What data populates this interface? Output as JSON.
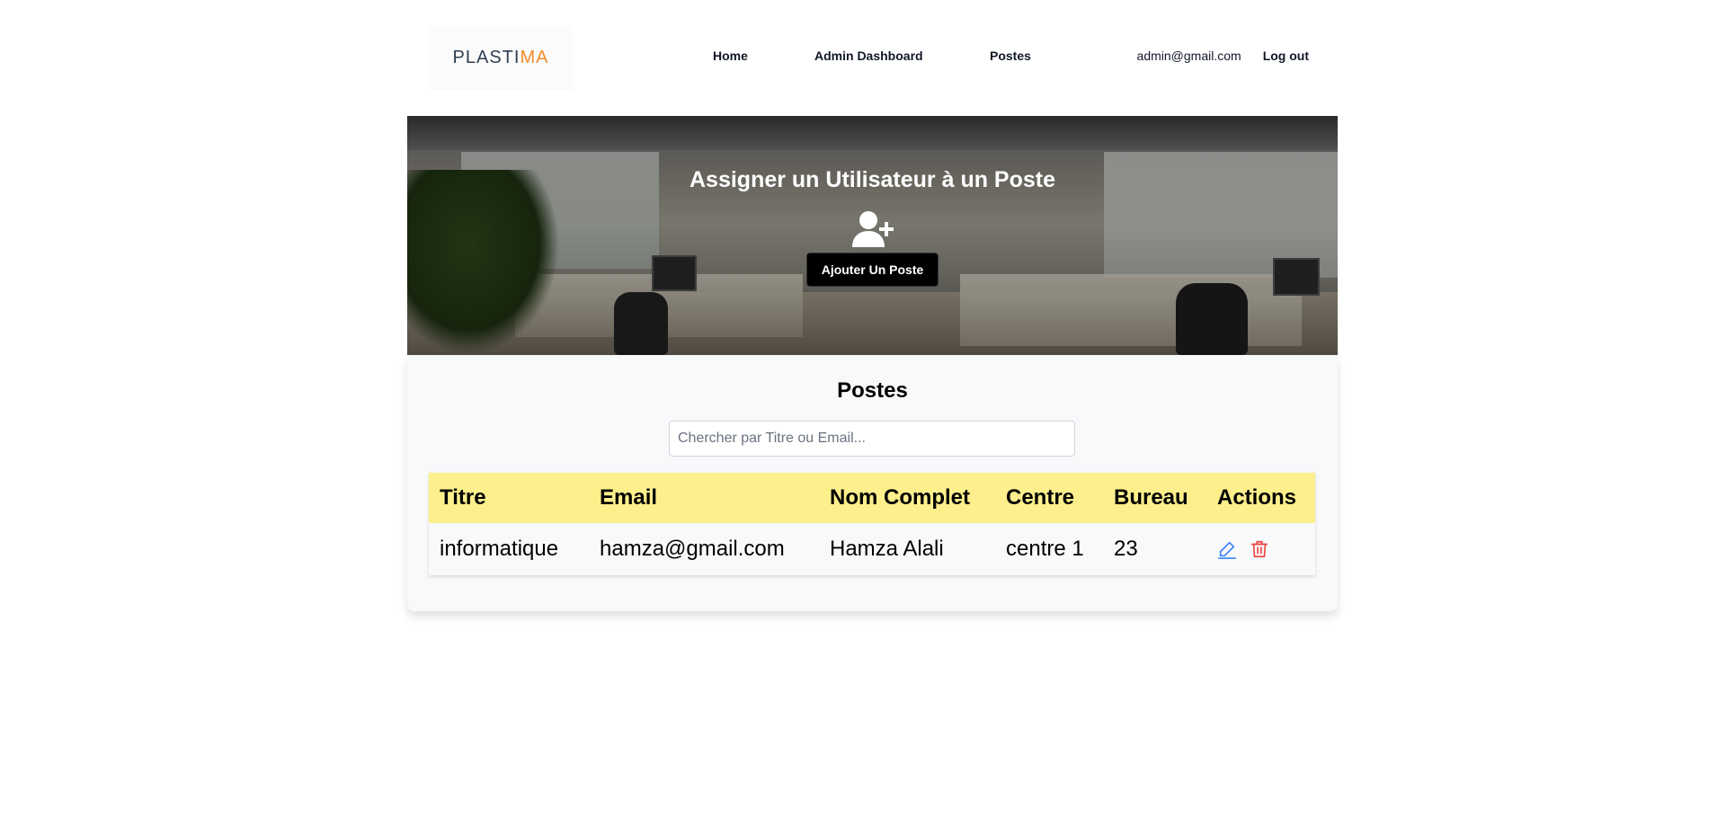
{
  "navbar": {
    "logo": {
      "part1": "PLASTI",
      "part2": "MA"
    },
    "links": [
      {
        "label": "Home"
      },
      {
        "label": "Admin Dashboard"
      },
      {
        "label": "Postes"
      }
    ],
    "user_email": "admin@gmail.com",
    "logout_label": "Log out"
  },
  "hero": {
    "title": "Assigner un Utilisateur à un Poste",
    "icon": "user-plus-icon",
    "button_label": "Ajouter Un Poste"
  },
  "postes": {
    "title": "Postes",
    "search": {
      "placeholder": "Chercher par Titre ou Email...",
      "value": ""
    },
    "columns": [
      "Titre",
      "Email",
      "Nom Complet",
      "Centre",
      "Bureau",
      "Actions"
    ],
    "rows": [
      {
        "titre": "informatique",
        "email": "hamza@gmail.com",
        "nom_complet": "Hamza Alali",
        "centre": "centre 1",
        "bureau": "23",
        "actions": [
          "edit-icon",
          "trash-icon"
        ]
      }
    ]
  },
  "colors": {
    "logo_primary": "#2f3e52",
    "logo_accent": "#f28c28",
    "table_header_bg": "#fdef8c",
    "edit_icon": "#3b82f6",
    "delete_icon": "#ef4444",
    "button_bg": "#000000"
  }
}
